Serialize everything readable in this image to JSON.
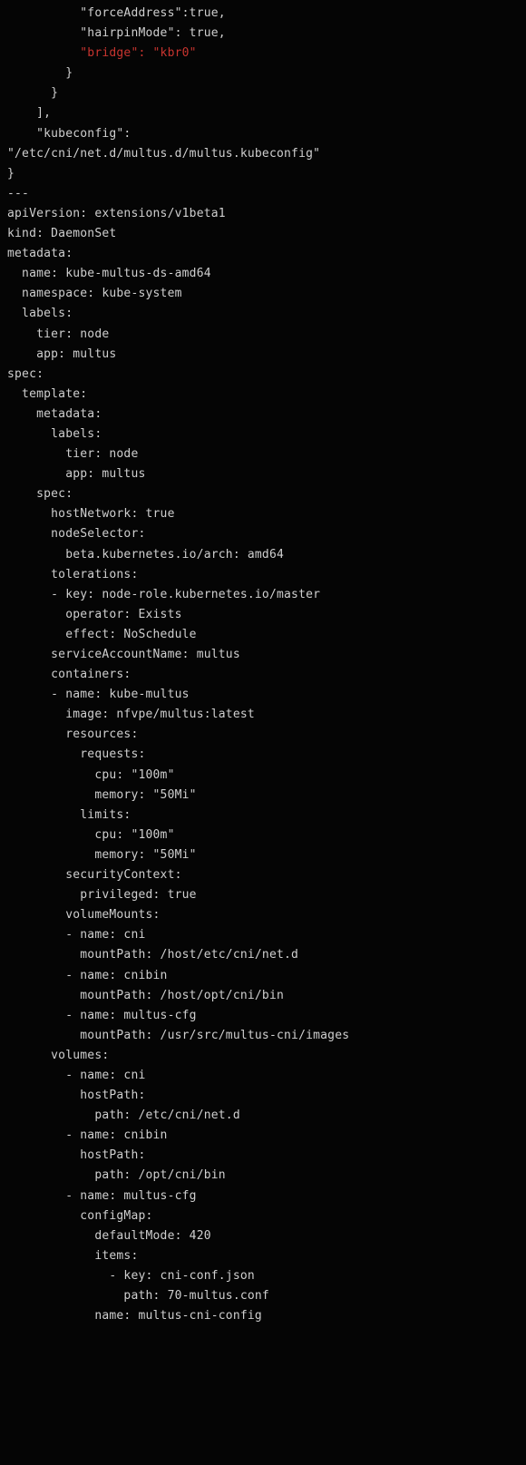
{
  "code": {
    "lines": [
      {
        "indent": 10,
        "text": "\"forceAddress\":true,",
        "highlight": false
      },
      {
        "indent": 10,
        "text": "\"hairpinMode\": true,",
        "highlight": false
      },
      {
        "indent": 10,
        "text": "\"bridge\": \"kbr0\"",
        "highlight": true
      },
      {
        "indent": 8,
        "text": "}",
        "highlight": false
      },
      {
        "indent": 6,
        "text": "}",
        "highlight": false
      },
      {
        "indent": 4,
        "text": "],",
        "highlight": false
      },
      {
        "indent": 4,
        "text": "\"kubeconfig\":",
        "highlight": false
      },
      {
        "indent": 0,
        "text": "\"/etc/cni/net.d/multus.d/multus.kubeconfig\"",
        "highlight": false
      },
      {
        "indent": 0,
        "text": "}",
        "highlight": false
      },
      {
        "indent": 0,
        "text": "---",
        "highlight": false
      },
      {
        "indent": 0,
        "text": "apiVersion: extensions/v1beta1",
        "highlight": false
      },
      {
        "indent": 0,
        "text": "kind: DaemonSet",
        "highlight": false
      },
      {
        "indent": 0,
        "text": "metadata:",
        "highlight": false
      },
      {
        "indent": 2,
        "text": "name: kube-multus-ds-amd64",
        "highlight": false
      },
      {
        "indent": 2,
        "text": "namespace: kube-system",
        "highlight": false
      },
      {
        "indent": 2,
        "text": "labels:",
        "highlight": false
      },
      {
        "indent": 4,
        "text": "tier: node",
        "highlight": false
      },
      {
        "indent": 4,
        "text": "app: multus",
        "highlight": false
      },
      {
        "indent": 0,
        "text": "spec:",
        "highlight": false
      },
      {
        "indent": 2,
        "text": "template:",
        "highlight": false
      },
      {
        "indent": 4,
        "text": "metadata:",
        "highlight": false
      },
      {
        "indent": 6,
        "text": "labels:",
        "highlight": false
      },
      {
        "indent": 8,
        "text": "tier: node",
        "highlight": false
      },
      {
        "indent": 8,
        "text": "app: multus",
        "highlight": false
      },
      {
        "indent": 4,
        "text": "spec:",
        "highlight": false
      },
      {
        "indent": 6,
        "text": "hostNetwork: true",
        "highlight": false
      },
      {
        "indent": 6,
        "text": "nodeSelector:",
        "highlight": false
      },
      {
        "indent": 8,
        "text": "beta.kubernetes.io/arch: amd64",
        "highlight": false
      },
      {
        "indent": 6,
        "text": "tolerations:",
        "highlight": false
      },
      {
        "indent": 6,
        "text": "- key: node-role.kubernetes.io/master",
        "highlight": false
      },
      {
        "indent": 8,
        "text": "operator: Exists",
        "highlight": false
      },
      {
        "indent": 8,
        "text": "effect: NoSchedule",
        "highlight": false
      },
      {
        "indent": 6,
        "text": "serviceAccountName: multus",
        "highlight": false
      },
      {
        "indent": 6,
        "text": "containers:",
        "highlight": false
      },
      {
        "indent": 6,
        "text": "- name: kube-multus",
        "highlight": false
      },
      {
        "indent": 8,
        "text": "image: nfvpe/multus:latest",
        "highlight": false
      },
      {
        "indent": 8,
        "text": "resources:",
        "highlight": false
      },
      {
        "indent": 10,
        "text": "requests:",
        "highlight": false
      },
      {
        "indent": 12,
        "text": "cpu: \"100m\"",
        "highlight": false
      },
      {
        "indent": 12,
        "text": "memory: \"50Mi\"",
        "highlight": false
      },
      {
        "indent": 10,
        "text": "limits:",
        "highlight": false
      },
      {
        "indent": 12,
        "text": "cpu: \"100m\"",
        "highlight": false
      },
      {
        "indent": 12,
        "text": "memory: \"50Mi\"",
        "highlight": false
      },
      {
        "indent": 8,
        "text": "securityContext:",
        "highlight": false
      },
      {
        "indent": 10,
        "text": "privileged: true",
        "highlight": false
      },
      {
        "indent": 8,
        "text": "volumeMounts:",
        "highlight": false
      },
      {
        "indent": 8,
        "text": "- name: cni",
        "highlight": false
      },
      {
        "indent": 10,
        "text": "mountPath: /host/etc/cni/net.d",
        "highlight": false
      },
      {
        "indent": 8,
        "text": "- name: cnibin",
        "highlight": false
      },
      {
        "indent": 10,
        "text": "mountPath: /host/opt/cni/bin",
        "highlight": false
      },
      {
        "indent": 8,
        "text": "- name: multus-cfg",
        "highlight": false
      },
      {
        "indent": 10,
        "text": "mountPath: /usr/src/multus-cni/images",
        "highlight": false
      },
      {
        "indent": 6,
        "text": "volumes:",
        "highlight": false
      },
      {
        "indent": 8,
        "text": "- name: cni",
        "highlight": false
      },
      {
        "indent": 10,
        "text": "hostPath:",
        "highlight": false
      },
      {
        "indent": 12,
        "text": "path: /etc/cni/net.d",
        "highlight": false
      },
      {
        "indent": 8,
        "text": "- name: cnibin",
        "highlight": false
      },
      {
        "indent": 10,
        "text": "hostPath:",
        "highlight": false
      },
      {
        "indent": 12,
        "text": "path: /opt/cni/bin",
        "highlight": false
      },
      {
        "indent": 8,
        "text": "- name: multus-cfg",
        "highlight": false
      },
      {
        "indent": 10,
        "text": "configMap:",
        "highlight": false
      },
      {
        "indent": 12,
        "text": "defaultMode: 420",
        "highlight": false
      },
      {
        "indent": 12,
        "text": "items:",
        "highlight": false
      },
      {
        "indent": 14,
        "text": "- key: cni-conf.json",
        "highlight": false
      },
      {
        "indent": 16,
        "text": "path: 70-multus.conf",
        "highlight": false
      },
      {
        "indent": 12,
        "text": "name: multus-cni-config",
        "highlight": false
      }
    ]
  }
}
